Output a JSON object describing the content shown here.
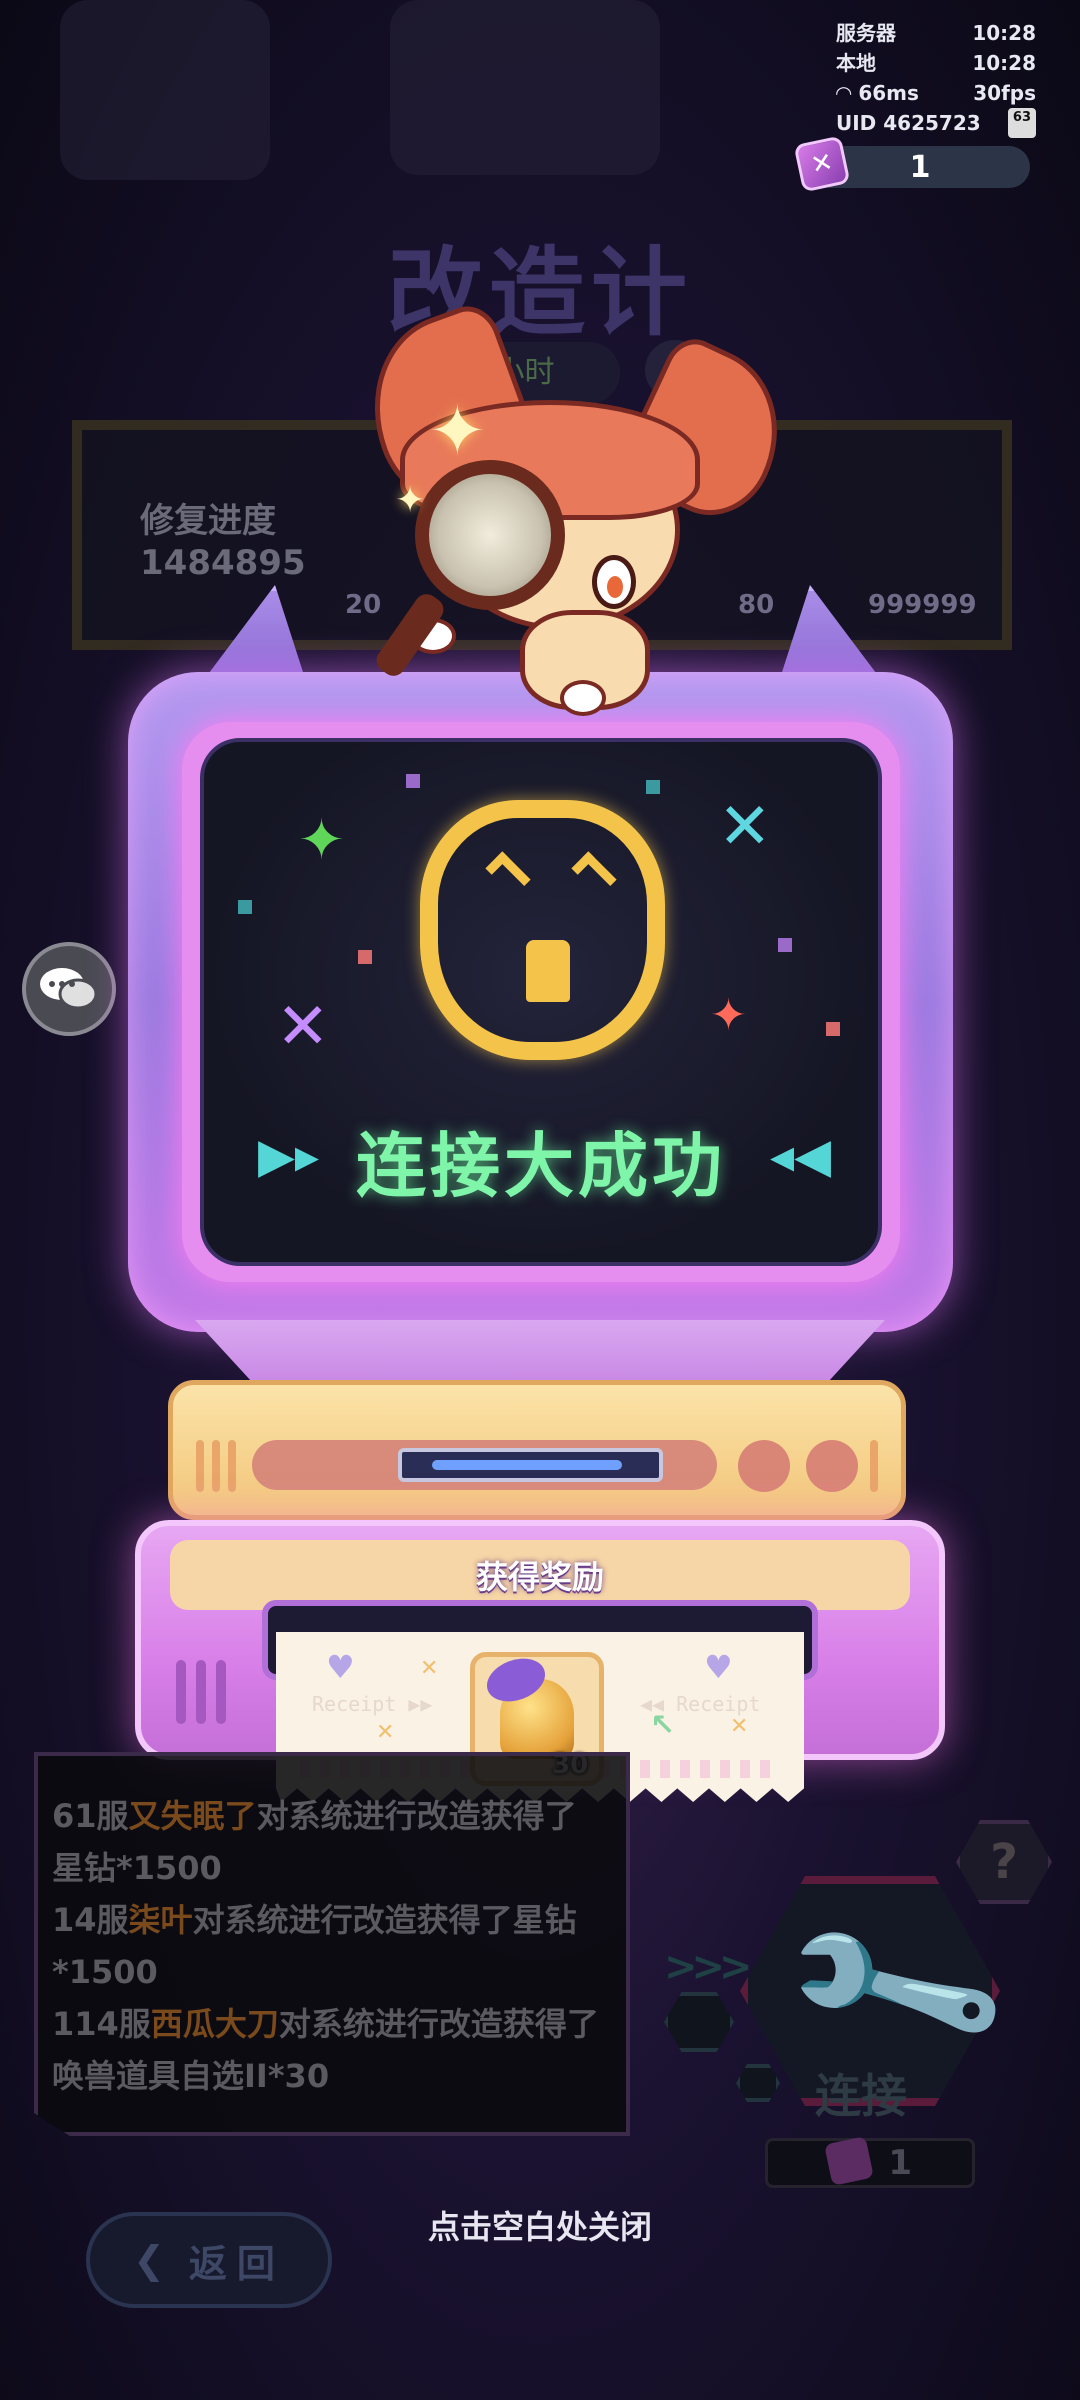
{
  "hud": {
    "server_label": "服务器",
    "server_time": "10:28",
    "local_label": "本地",
    "local_time": "10:28",
    "ping": "66ms",
    "fps": "30fps",
    "uid": "UID 4625723",
    "battery": "63"
  },
  "currency": {
    "count": "1",
    "icon": "gem-ticket-icon"
  },
  "background": {
    "title": "改造计划",
    "timer": "8小时",
    "progress_label": "修复进度",
    "progress_value": "1484895",
    "milestone_low": "20",
    "milestone_mid": "80",
    "milestone_high": "999999"
  },
  "screen": {
    "success_text": "连接大成功",
    "face_color": "#f4c44a",
    "text_color": "#7ef5a8"
  },
  "reward": {
    "label": "获得奖励",
    "receipt_left": "Receipt ▶▶",
    "receipt_right": "◀◀ Receipt",
    "item_icon": "golden-bell-icon",
    "item_count": "30"
  },
  "log": {
    "lines": [
      {
        "prefix": "61服",
        "name": "又失眠了",
        "suffix": "对系统进行改造获得了"
      },
      {
        "prefix": "",
        "name": "",
        "suffix": "星钻*1500"
      },
      {
        "prefix": "14服",
        "name": "柒叶",
        "suffix": "对系统进行改造获得了星钻"
      },
      {
        "prefix": "",
        "name": "",
        "suffix": "*1500"
      },
      {
        "prefix": "114服",
        "name": "西瓜大刀",
        "suffix": "对系统进行改造获得了"
      },
      {
        "prefix": "",
        "name": "",
        "suffix": "唤兽道具自选II*30"
      }
    ]
  },
  "actions": {
    "help": "?",
    "connect": "连接",
    "connect_cost": "1",
    "close_hint": "点击空白处关闭",
    "back": "返回"
  }
}
